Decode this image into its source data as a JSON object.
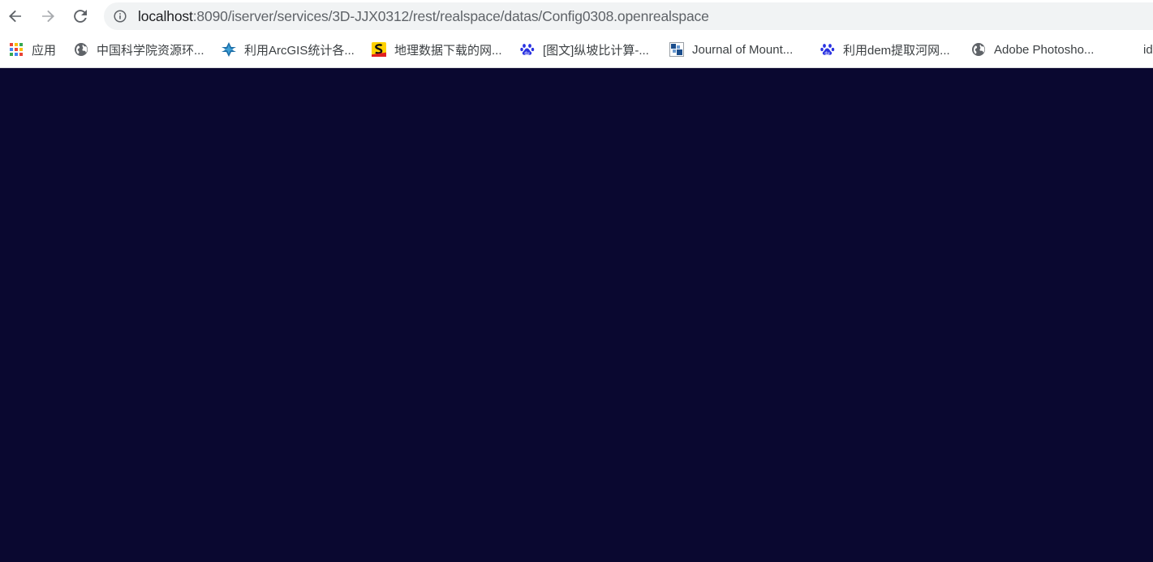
{
  "toolbar": {
    "back_icon": "arrow-left-icon",
    "forward_icon": "arrow-right-icon",
    "reload_icon": "reload-icon"
  },
  "address_bar": {
    "host": "localhost",
    "rest": ":8090/iserver/services/3D-JJX0312/rest/realspace/datas/Config0308.openrealspace",
    "info_icon": "info-circle-icon"
  },
  "bookmarks": {
    "items": [
      {
        "label": "应用",
        "icon": "apps-grid-icon"
      },
      {
        "label": "中国科学院资源环...",
        "icon": "globe-icon"
      },
      {
        "label": "利用ArcGIS统计各...",
        "icon": "arcgis-icon"
      },
      {
        "label": "地理数据下载的网...",
        "icon": "s-logo-icon"
      },
      {
        "label": "[图文]纵坡比计算-...",
        "icon": "baidu-paw-icon"
      },
      {
        "label": "Journal of Mount...",
        "icon": "journal-icon"
      },
      {
        "label": "利用dem提取河网...",
        "icon": "baidu-paw-icon"
      },
      {
        "label": "Adobe Photosho...",
        "icon": "globe-icon"
      },
      {
        "label": "id",
        "icon": ""
      }
    ]
  },
  "colors": {
    "viewport_background": "#0a0830",
    "omnibox_background": "#f1f3f4",
    "url_host": "#202124",
    "url_rest": "#5f6368"
  }
}
